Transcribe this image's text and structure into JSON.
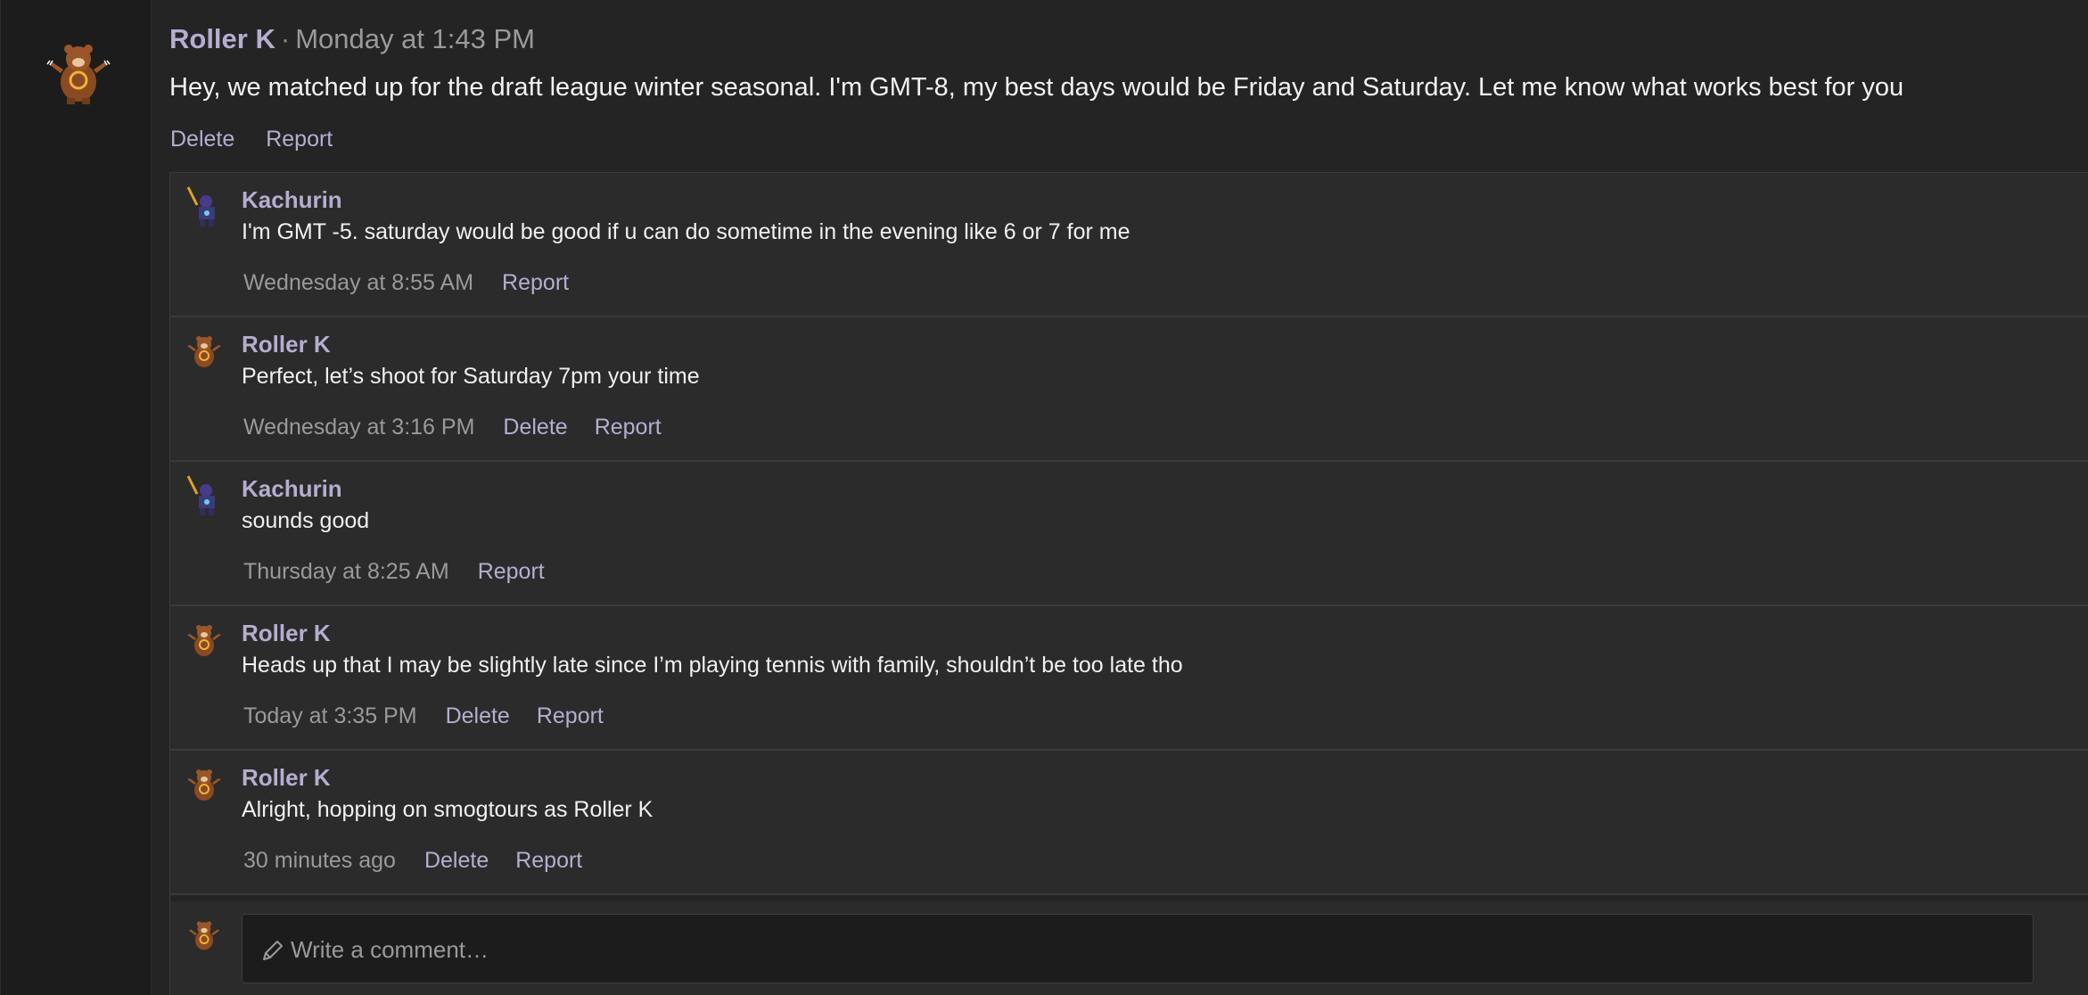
{
  "post": {
    "author": "Roller K",
    "separator": "·",
    "time": "Monday at 1:43 PM",
    "body": "Hey, we matched up for the draft league winter seasonal. I'm GMT-8, my best days would be Friday and Saturday. Let me know what works best for you",
    "actions": {
      "delete": "Delete",
      "report": "Report"
    },
    "avatar_icon": "bear-pokemon-avatar-icon"
  },
  "comments": [
    {
      "author": "Kachurin",
      "text": "I'm GMT -5. saturday would be good if u can do sometime in the evening like 6 or 7 for me",
      "time": "Wednesday at 8:55 AM",
      "report": "Report",
      "avatar_icon": "warrior-sprite-avatar-icon"
    },
    {
      "author": "Roller K",
      "text": "Perfect, let’s shoot for Saturday 7pm your time",
      "time": "Wednesday at 3:16 PM",
      "delete": "Delete",
      "report": "Report",
      "avatar_icon": "bear-pokemon-avatar-icon"
    },
    {
      "author": "Kachurin",
      "text": "sounds good",
      "time": "Thursday at 8:25 AM",
      "report": "Report",
      "avatar_icon": "warrior-sprite-avatar-icon"
    },
    {
      "author": "Roller K",
      "text": "Heads up that I may be slightly late since I’m playing tennis with family, shouldn’t be too late tho",
      "time": "Today at 3:35 PM",
      "delete": "Delete",
      "report": "Report",
      "avatar_icon": "bear-pokemon-avatar-icon"
    },
    {
      "author": "Roller K",
      "text": "Alright, hopping on smogtours as Roller K",
      "time": "30 minutes ago",
      "delete": "Delete",
      "report": "Report",
      "avatar_icon": "bear-pokemon-avatar-icon"
    }
  ],
  "composer": {
    "placeholder": "Write a comment…",
    "icon": "pencil-icon",
    "avatar_icon": "bear-pokemon-avatar-icon"
  },
  "colors": {
    "background": "#242424",
    "comment_bg": "#2b2b2b",
    "accent": "#b6add0",
    "text": "#f0f0f0",
    "muted": "#9a9a9a"
  }
}
